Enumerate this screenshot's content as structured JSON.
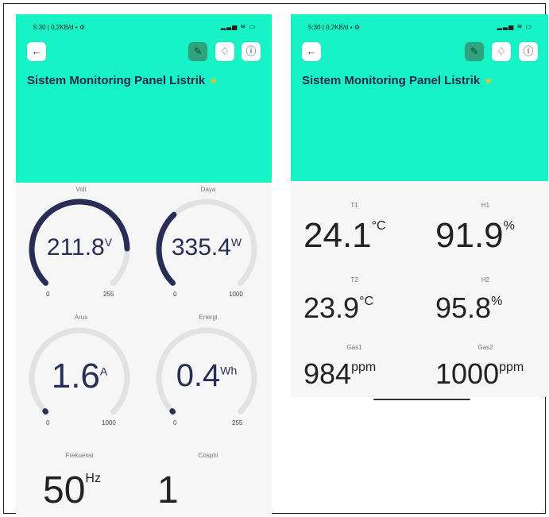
{
  "screens": [
    {
      "status_time": "5:30 | 0,2KB/d",
      "title": "Sistem Monitoring Panel Listrik",
      "gauges": [
        {
          "label": "Volt",
          "value": "211.8",
          "unit": "V",
          "min": "0",
          "max": "255",
          "fraction": 0.83
        },
        {
          "label": "Daya",
          "value": "335.4",
          "unit": "W",
          "min": "0",
          "max": "1000",
          "fraction": 0.34
        },
        {
          "label": "Arus",
          "value": "1.6",
          "unit": "A",
          "min": "0",
          "max": "1000",
          "fraction": 0.002
        },
        {
          "label": "Energi",
          "value": "0.4",
          "unit": "Wh",
          "min": "0",
          "max": "255",
          "fraction": 0.002
        }
      ],
      "readouts": [
        {
          "label": "Frekuensi",
          "value": "50",
          "unit": "Hz"
        },
        {
          "label": "Cosphi",
          "value": "1",
          "unit": ""
        }
      ]
    },
    {
      "status_time": "5:30 | 0,2KB/d",
      "title": "Sistem Monitoring Panel Listrik",
      "readouts": [
        {
          "label": "T1",
          "value": "24.1",
          "unit": "°C"
        },
        {
          "label": "H1",
          "value": "91.9",
          "unit": "%"
        },
        {
          "label": "T2",
          "value": "23.9",
          "unit": "°C"
        },
        {
          "label": "H2",
          "value": "95.8",
          "unit": "%"
        },
        {
          "label": "Gas1",
          "value": "984",
          "unit": "ppm"
        },
        {
          "label": "Gas2",
          "value": "1000",
          "unit": "ppm"
        }
      ]
    }
  ],
  "icons": {
    "back": "arrow-left-icon",
    "tool": "wrench-icon",
    "bell": "bell-icon",
    "info": "info-icon",
    "gear": "gear-icon",
    "sim": "sim-card-icon",
    "signal": "signal-icon",
    "wifi": "wifi-icon",
    "battery": "battery-icon"
  },
  "colors": {
    "header": "#17f2c6",
    "gauge_fill": "#282d55",
    "gauge_track": "#e2e2e2",
    "tool_button": "#2fa27e",
    "star": "#f0c419"
  }
}
